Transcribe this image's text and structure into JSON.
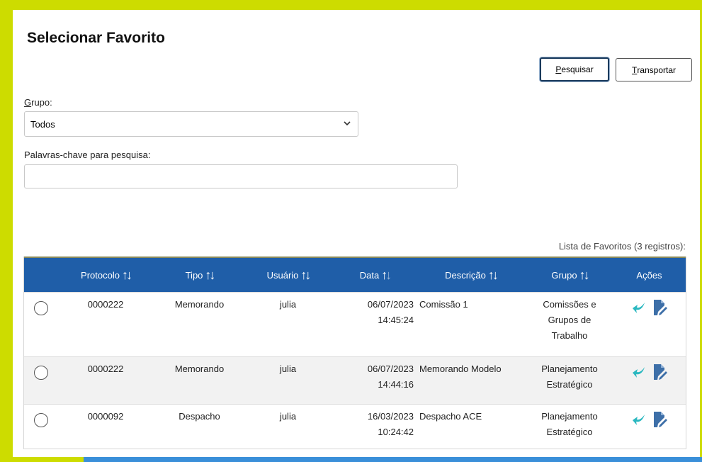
{
  "page": {
    "title": "Selecionar Favorito"
  },
  "toolbar": {
    "search_first": "P",
    "search_rest": "esquisar",
    "transport_first": "T",
    "transport_rest": "ransportar"
  },
  "form": {
    "group_label_first": "G",
    "group_label_rest": "rupo:",
    "group_selected": "Todos",
    "keywords_label": "Palavras-chave para pesquisa:",
    "keywords_value": ""
  },
  "table": {
    "caption": "Lista de Favoritos (3 registros):",
    "headers": {
      "protocolo": "Protocolo",
      "tipo": "Tipo",
      "usuario": "Usuário",
      "data": "Data",
      "descricao": "Descrição",
      "grupo": "Grupo",
      "acoes": "Ações"
    },
    "rows": [
      {
        "protocolo": "0000222",
        "tipo": "Memorando",
        "usuario": "julia",
        "date": "06/07/2023",
        "time": "14:45:24",
        "descricao": "Comissão 1",
        "grupo_l1": "Comissões e",
        "grupo_l2": "Grupos de",
        "grupo_l3": "Trabalho"
      },
      {
        "protocolo": "0000222",
        "tipo": "Memorando",
        "usuario": "julia",
        "date": "06/07/2023",
        "time": "14:44:16",
        "descricao": "Memorando Modelo",
        "grupo_l1": "Planejamento",
        "grupo_l2": "Estratégico"
      },
      {
        "protocolo": "0000092",
        "tipo": "Despacho",
        "usuario": "julia",
        "date": "16/03/2023",
        "time": "10:24:42",
        "descricao": "Despacho ACE",
        "grupo_l1": "Planejamento",
        "grupo_l2": "Estratégico"
      }
    ]
  },
  "icons": {
    "return": "arrow-return-icon",
    "edit": "document-edit-icon",
    "chevron": "chevron-down-icon"
  },
  "colors": {
    "header_bg": "#1f5ea8",
    "accent": "#2bb8c0",
    "edit_icon": "#3d6fa8",
    "frame": "#cddc00",
    "bottom_bar": "#3a8fd9"
  }
}
